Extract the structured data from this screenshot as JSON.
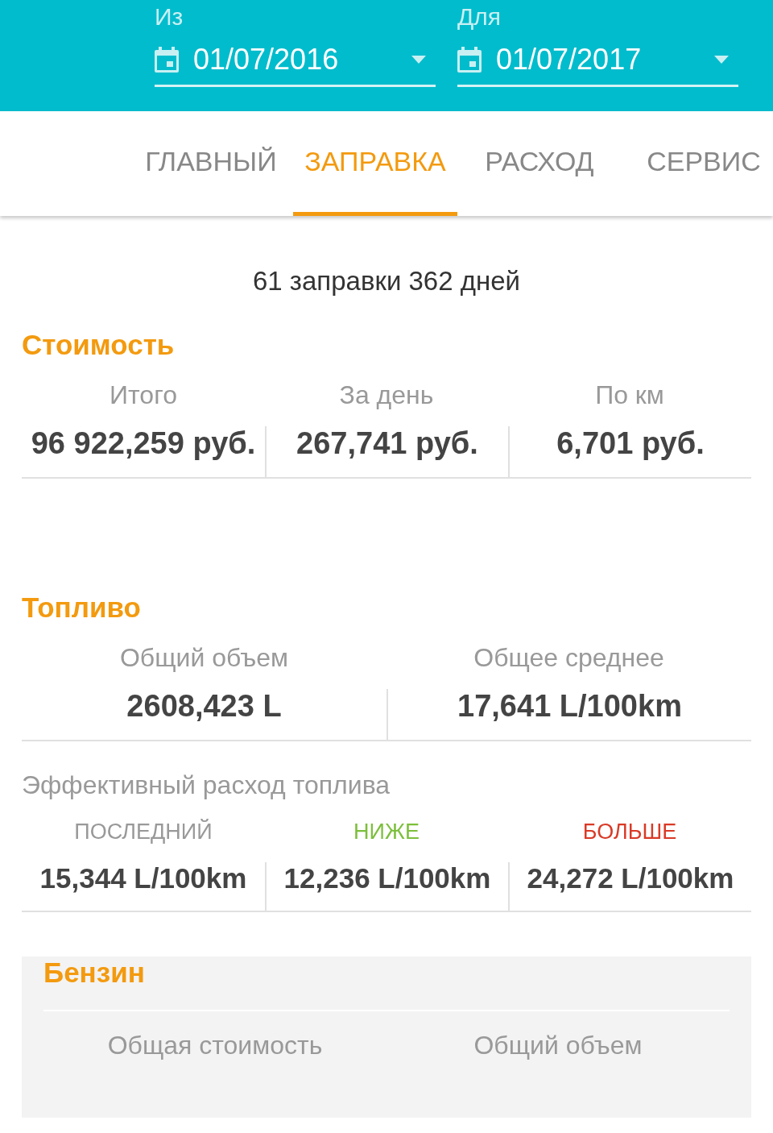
{
  "date_range": [
    {
      "label": "Из",
      "value": "01/07/2016"
    },
    {
      "label": "Для",
      "value": "01/07/2017"
    }
  ],
  "tabs": [
    {
      "label": "ГЛАВНЫЙ",
      "selected": false
    },
    {
      "label": "ЗАПРАВКА",
      "selected": true
    },
    {
      "label": "РАСХОД",
      "selected": false
    },
    {
      "label": "СЕРВИС",
      "selected": false
    }
  ],
  "summary": "61 заправки 362 дней",
  "cost": {
    "title": "Стоимость",
    "stats": [
      {
        "label": "Итого",
        "value": "96 922,259 руб."
      },
      {
        "label": "За день",
        "value": "267,741 руб."
      },
      {
        "label": "По км",
        "value": "6,701 руб."
      }
    ]
  },
  "fuel": {
    "title": "Топливо",
    "stats": [
      {
        "label": "Общий объем",
        "value": "2608,423 L"
      },
      {
        "label": "Общее среднее",
        "value": "17,641 L/100km"
      }
    ],
    "efficiency_title": "Эффективный расход топлива",
    "efficiency": [
      {
        "label": "ПОСЛЕДНИЙ",
        "color": "#999999",
        "value": "15,344 L/100km"
      },
      {
        "label": "НИЖЕ",
        "color": "#7cbf3a",
        "value": "12,236 L/100km"
      },
      {
        "label": "БОЛЬШЕ",
        "color": "#d93a26",
        "value": "24,272 L/100km"
      }
    ]
  },
  "petrol": {
    "title": "Бензин",
    "labels": [
      "Общая стоимость",
      "Общий объем"
    ]
  }
}
